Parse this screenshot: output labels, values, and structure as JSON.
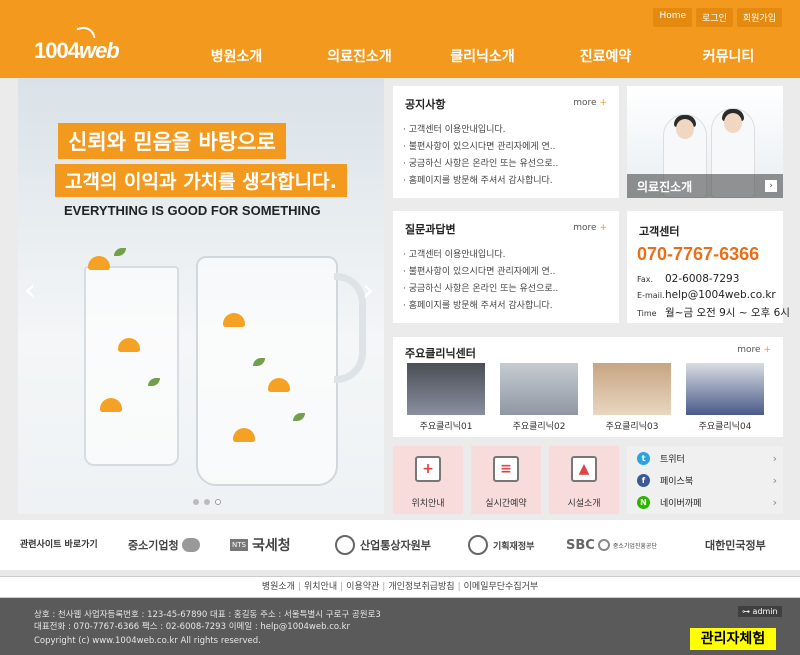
{
  "header": {
    "logo_num": "1004",
    "logo_web": "web",
    "top_links": [
      "Home",
      "로그인",
      "회원가입"
    ],
    "nav": [
      "병원소개",
      "의료진소개",
      "클리닉소개",
      "진료예약",
      "커뮤니티"
    ]
  },
  "visual": {
    "headline1": "신뢰와 믿음을 바탕으로",
    "headline2": "고객의 이익과 가치를 생각합니다.",
    "subline": "EVERYTHING IS GOOD FOR SOMETHING",
    "prev": "‹",
    "next": "›"
  },
  "notice": {
    "title": "공지사항",
    "more": "more",
    "items": [
      "· 고객센터 이용안내입니다.",
      "· 불편사항이 있으시다면 관리자에게 연..",
      "· 궁금하신 사항은 온라인 또는 유선으로..",
      "· 홈페이지를 방문해 주셔서 감사합니다."
    ]
  },
  "qna": {
    "title": "질문과답변",
    "more": "more",
    "items": [
      "· 고객센터 이용안내입니다.",
      "· 불편사항이 있으시다면 관리자에게 연..",
      "· 궁금하신 사항은 온라인 또는 유선으로..",
      "· 홈페이지를 방문해 주셔서 감사합니다."
    ]
  },
  "promo": {
    "label": "의료진소개",
    "go": "›"
  },
  "cs": {
    "title": "고객센터",
    "phone": "070-7767-6366",
    "fax_label": "Fax.",
    "fax": "02-6008-7293",
    "email_label": "E-mail.",
    "email": "help@1004web.co.kr",
    "time_label": "Time",
    "time": "월~금 오전 9시 ~ 오후 6시"
  },
  "clinics": {
    "title": "주요클리닉센터",
    "more": "more",
    "items": [
      "주요클리닉01",
      "주요클리닉02",
      "주요클리닉03",
      "주요클리닉04"
    ]
  },
  "quick": [
    {
      "label": "위치안내",
      "mark": "+"
    },
    {
      "label": "실시간예약",
      "mark": "≡"
    },
    {
      "label": "시설소개",
      "mark": "▲"
    }
  ],
  "sns": [
    {
      "label": "트위터",
      "letter": "t",
      "color": "#2aa3e0"
    },
    {
      "label": "페이스북",
      "letter": "f",
      "color": "#3b5998"
    },
    {
      "label": "네이버까페",
      "letter": "N",
      "color": "#2db400"
    }
  ],
  "family": {
    "title": "관련사이트 바로가기",
    "sites": [
      "중소기업청",
      "국세청",
      "산업통상자원부",
      "기획재정부",
      "SBC",
      "중소기업진흥공단",
      "대한민국정부"
    ],
    "nts_badge": "NTS"
  },
  "footer": {
    "links": [
      "병원소개",
      "위치안내",
      "이용약관",
      "개인정보취급방침",
      "이메일무단수집거부"
    ],
    "line1": "상호 : 천사웹   사업자등록번호 : 123-45-67890  대표 : 홍길동  주소 : 서울특별시 구로구 공원로3",
    "line2": "대표전화 : 070-7767-6366  팩스 : 02-6008-7293  이메일 : help@1004web.co.kr",
    "copyright": "Copyright (c) www.1004web.co.kr All rights reserved.",
    "admin": "⊶ admin",
    "demo": "관리자체험"
  },
  "colors": {
    "accent": "#f39a1e",
    "phone": "#e8701a",
    "quick_bg": "#f8dcdc",
    "footer_bg": "#5a5a5a"
  }
}
